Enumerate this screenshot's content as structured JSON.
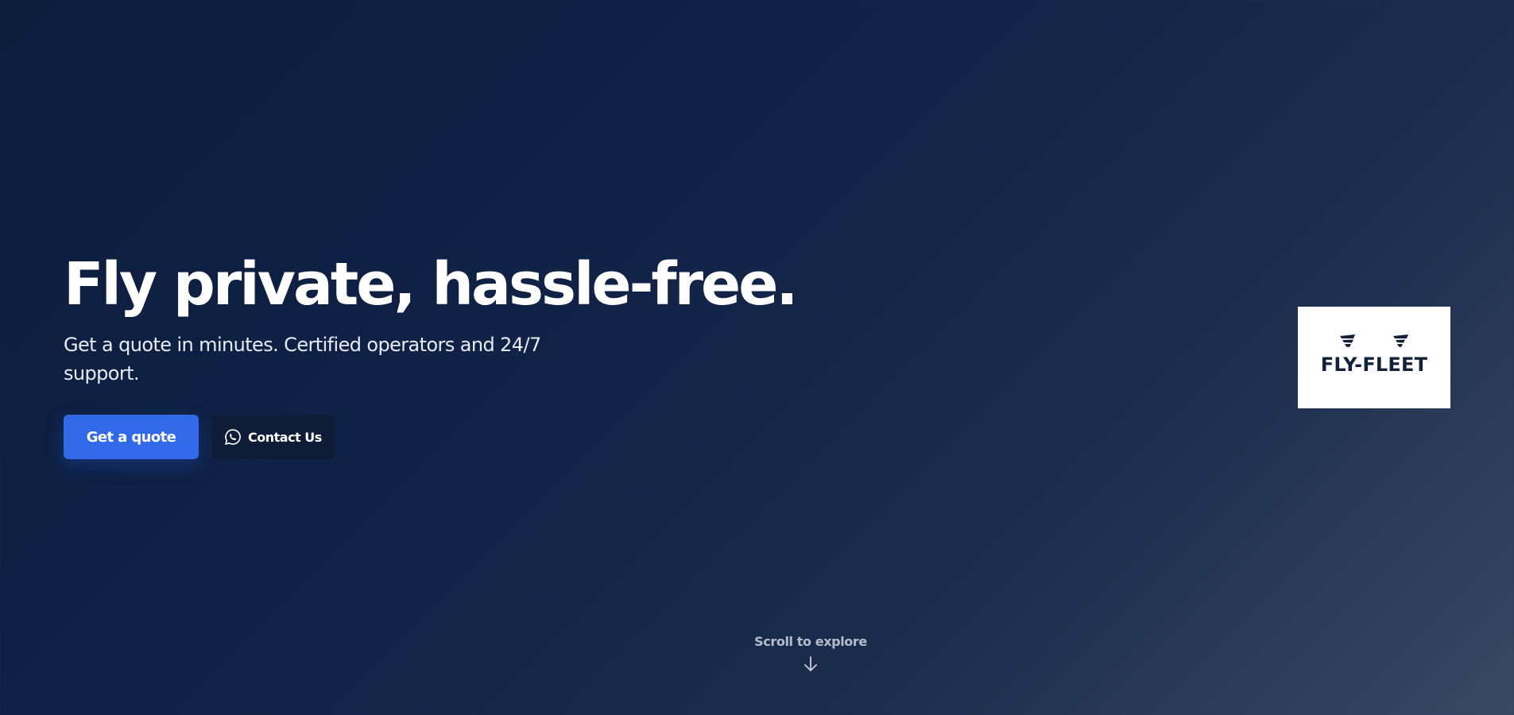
{
  "hero": {
    "title": "Fly private, hassle-free.",
    "subtitle": "Get a quote in minutes. Certified operators and 24/7 support."
  },
  "actions": {
    "primary_label": "Get a quote",
    "secondary_label": "Contact Us",
    "secondary_icon": "whatsapp-icon"
  },
  "logo": {
    "text": "FLY-FLEET",
    "icon": "wings-icon"
  },
  "scroll": {
    "label": "Scroll to explore",
    "icon": "arrow-down-icon"
  },
  "colors": {
    "background_start": "#0c1d3c",
    "background_end": "#3a4863",
    "primary_button": "#3169e8",
    "secondary_button": "#0e1c37",
    "logo_text": "#12223a",
    "logo_card": "#ffffff"
  }
}
